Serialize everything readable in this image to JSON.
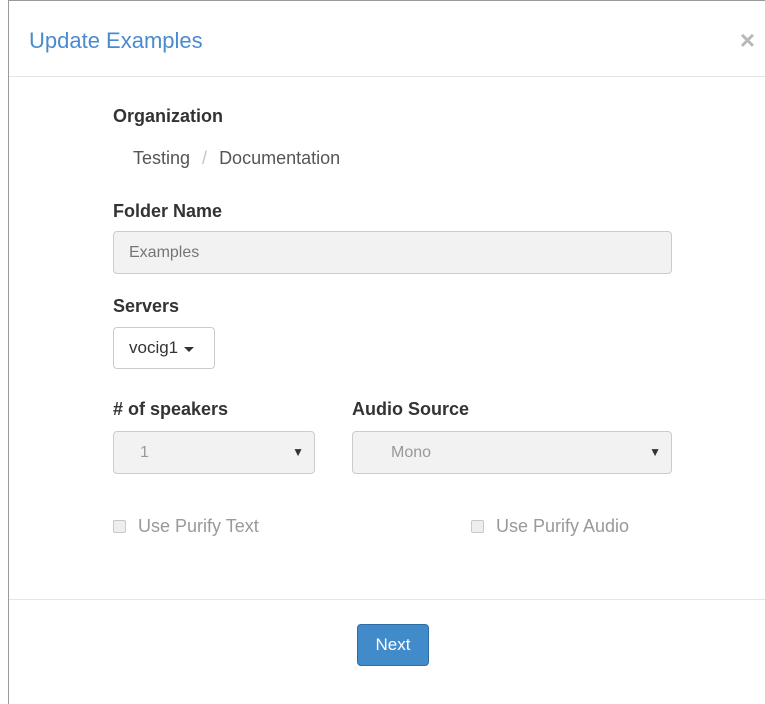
{
  "dialog": {
    "title": "Update Examples",
    "close_glyph": "×"
  },
  "organization": {
    "label": "Organization",
    "breadcrumb": [
      "Testing",
      "Documentation"
    ],
    "separator": "/"
  },
  "folder": {
    "label": "Folder Name",
    "placeholder": "Examples"
  },
  "servers": {
    "label": "Servers",
    "selected": "vocig1"
  },
  "speakers": {
    "label": "# of speakers",
    "selected": "1"
  },
  "audio_source": {
    "label": "Audio Source",
    "selected": "Mono"
  },
  "options": {
    "purify_text": "Use Purify Text",
    "purify_audio": "Use Purify Audio"
  },
  "footer": {
    "next_label": "Next"
  },
  "colors": {
    "title": "#4a8bd0",
    "primary_button": "#428bca"
  }
}
